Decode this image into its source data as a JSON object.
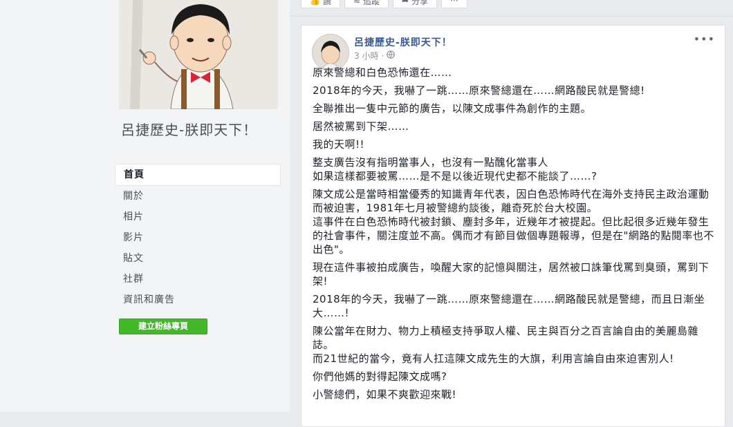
{
  "sidebar": {
    "page_name": "呂捷歷史-朕即天下！",
    "nav": [
      "首頁",
      "關於",
      "相片",
      "影片",
      "貼文",
      "社群",
      "資訊和廣告"
    ],
    "create_page_label": "建立粉絲專頁"
  },
  "top_actions": [
    {
      "label": "讚",
      "icon": "like-icon"
    },
    {
      "label": "追蹤",
      "icon": "rss-icon"
    },
    {
      "label": "分享",
      "icon": "share-icon"
    },
    {
      "label": "···",
      "icon": "more-icon"
    }
  ],
  "post": {
    "author": "呂捷歷史-朕即天下！",
    "time": "3 小時",
    "dot": "·",
    "more": "•••",
    "paragraphs": [
      "原來警總和白色恐怖還在……",
      "2018年的今天，我嚇了一跳……原來警總還在……網路酸民就是警總!",
      "全聯推出一隻中元節的廣告，以陳文成事件為創作的主題。",
      "居然被罵到下架……",
      "我的天啊!!",
      "整支廣告沒有指明當事人，也沒有一點醜化當事人\n如果這樣都要被罵……是不是以後近現代史都不能談了……?",
      "陳文成公是當時相當優秀的知識青年代表，因白色恐怖時代在海外支持民主政治運動而被迫害，1981年七月被警總約談後，離奇死於台大校園。\n這事件在白色恐怖時代被封鎖、塵封多年，近幾年才被提起。但比起很多近幾年發生的社會事件，關注度並不高。偶而才有節目做個專題報導，但是在\"網路的點閱率也不出色\"。",
      "現在這件事被拍成廣告，喚醒大家的記憶與關注，居然被口誅筆伐罵到臭頭，罵到下架!",
      "2018年的今天，我嚇了一跳……原來警總還在……網路酸民就是警總，而且日漸坐大……!",
      "陳公當年在財力、物力上積極支持爭取人權、民主與百分之百言論自由的美麗島雜誌。\n而21世紀的當今，竟有人扛這陳文成先生的大旗，利用言論自由來迫害別人!",
      "你們他媽的對得起陳文成嗎?",
      "小警總們，如果不爽歡迎來戰!"
    ]
  }
}
